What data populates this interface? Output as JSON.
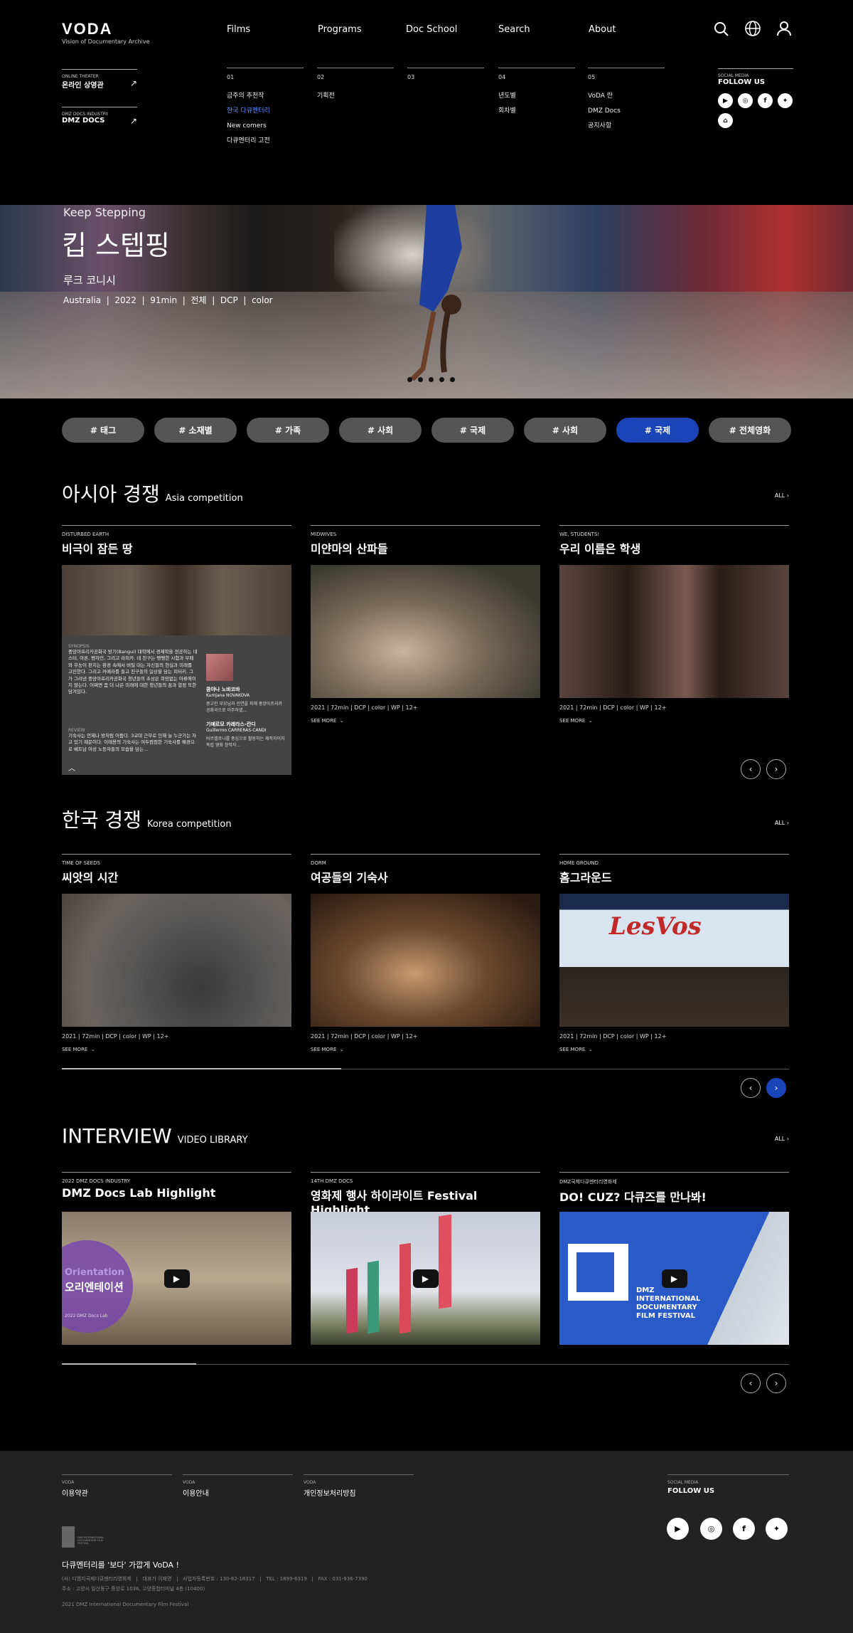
{
  "header": {
    "logo": "VODA",
    "logo_sub": "Vision of Documentary Archive",
    "nav": [
      "Films",
      "Programs",
      "Doc School",
      "Search",
      "About"
    ],
    "side_links": [
      {
        "kicker": "ONLINE THEATER",
        "label": "온라인 상영관"
      },
      {
        "kicker": "DMZ DOCS INDUSTRY",
        "label": "DMZ DOCS"
      }
    ],
    "columns": [
      {
        "num": "01",
        "items": [
          "금주의 추천작",
          "한국 다큐멘터리",
          "New comers",
          "다큐멘터리 고전"
        ],
        "active": 1
      },
      {
        "num": "02",
        "items": [
          "기획전"
        ]
      },
      {
        "num": "03",
        "items": []
      },
      {
        "num": "04",
        "items": [
          "년도별",
          "회차별"
        ]
      },
      {
        "num": "05",
        "items": [
          "VoDA 란",
          "DMZ Docs",
          "공지사항"
        ]
      }
    ],
    "social": {
      "kicker": "SOCIAL MEDIA",
      "label": "FOLLOW US"
    }
  },
  "hero": {
    "en_title": "Keep Stepping",
    "title": "킵 스텝핑",
    "director": "루크 코니시",
    "meta": [
      "Australia",
      "2022",
      "91min",
      "전체",
      "DCP",
      "color"
    ]
  },
  "tags": [
    "# 태그",
    "# 소재별",
    "# 가족",
    "# 사회",
    "# 국제",
    "# 사회",
    "# 국제",
    "# 전체영화"
  ],
  "tag_active": 6,
  "asia": {
    "title": "아시아 경쟁",
    "sub": "Asia competition",
    "all": "ALL",
    "cards": [
      {
        "kicker": "DISTURBED EARTH",
        "title": "비극이 잠든 땅"
      },
      {
        "kicker": "MIDWIVES",
        "title": "미얀마의 산파들",
        "meta": "2021  |  72min  |  DCP  |  color  |  WP  |  12+",
        "see": "SEE MORE"
      },
      {
        "kicker": "WE, STUDENTS!",
        "title": "우리 이름은 학생",
        "meta": "2021  |  72min  |  DCP  |  color  |  WP  |  12+",
        "see": "SEE MORE"
      }
    ],
    "popup": {
      "syn_label": "SYNOPSIS",
      "synopsis": "중앙아프리카공화국 방기(Bangui) 대학에서 경제학을 전공하는 네스터, 아론, 벤자민, 그리고 라피카. 네 친구는 팽팽한 시험과 부패와 무능이 판치는 환경 속에서 버틸 대는 자신들의 현실과 미래를 고민한다. 그리고 카메라를 들고 친구들의 일상을 담는 피터키. 그가 그려낸 중앙아프리카공화국 청년들의 초상은 희망없는 아류에이지 않는다. 어쩌면 좀 더 나은 미래에 대한 청년들의 꿈과 열정 또한 담겨있다.",
      "rev_label": "REVIEW",
      "review": "기숙사는 언제나 방처럼 어둡다. 3교대 근무로 인해 늘 누군가는 자고 있기 때문이다. 이태용의 기숙사는 여두컴컴한 기숙사를 배경으로 베트남 여성 노동자들의 모습을 담는...",
      "people": [
        {
          "name": "쿰야나 노바코바",
          "en": "Kumjana NOVAKOVA",
          "desc": "중고인 부모님과 인연을 피해 중앙아프리카공화국으로 이주하였..."
        },
        {
          "name": "기예르모 카레라스-칸디",
          "en": "Guillermo CARRERAS-CANDI",
          "desc": "바르셀로나를 중심으로 활동하는 제작자이자 독립 영화 창작자..."
        }
      ]
    }
  },
  "korea": {
    "title": "한국 경쟁",
    "sub": "Korea competition",
    "all": "ALL",
    "cards": [
      {
        "kicker": "TIME OF SEEDS",
        "title": "씨앗의 시간",
        "meta": "2021  |  72min  |  DCP  |  color  |  WP  |  12+",
        "see": "SEE MORE"
      },
      {
        "kicker": "DORM",
        "title": "여공들의 기숙사",
        "meta": "2021  |  72min  |  DCP  |  color  |  WP  |  12+",
        "see": "SEE MORE"
      },
      {
        "kicker": "HOME GROUND",
        "title": "홈그라운드",
        "meta": "2021  |  72min  |  DCP  |  color  |  WP  |  12+",
        "see": "SEE MORE",
        "sign": "LesVos"
      }
    ]
  },
  "interview": {
    "title": "INTERVIEW",
    "sub": "VIDEO LIBRARY",
    "all": "ALL",
    "cards": [
      {
        "kicker": "2022 DMZ DOCS INDUSTRY",
        "title": "DMZ Docs Lab Highlight",
        "overlay": "Orientation",
        "overlay_kr": "오리엔테이션",
        "corner": "2022 DMZ Docs Lab"
      },
      {
        "kicker": "14TH DMZ DOCS",
        "title": "영화제 행사 하이라이트 Festival Highlight"
      },
      {
        "kicker": "DMZ국제다큐멘터리영화제",
        "title": "DO! CUZ? 다큐즈를 만나봐!",
        "overlay": "DMZ INTERNATIONAL DOCUMENTARY FILM FESTIVAL"
      }
    ]
  },
  "footer": {
    "cols": [
      {
        "kicker": "VODA",
        "label": "이용약관"
      },
      {
        "kicker": "VODA",
        "label": "이용안내"
      },
      {
        "kicker": "VODA",
        "label": "개인정보처리방침"
      }
    ],
    "social": {
      "kicker": "SOCIAL MEDIA",
      "label": "FOLLOW US"
    },
    "slogan": "다큐멘터리를 '보다' 가깝게 VoDA !",
    "info1": "(사) 디엠지국제다큐멘터리영화제   |   대표가 이재명   |   사업자등록번호 : 130-82-18317   |   TEL : 1899-6319   |   FAX : 031-936-7390",
    "info2": "주소 : 고양시 일산동구 중앙로 1036, 고양종합터미널 4층 (10400)",
    "copy": "2021 DMZ International Documentary Film Festival",
    "logo_text": "DMZ INTERNATIONAL DOCUMENTARY FILM FESTIVAL"
  },
  "colors": {
    "accent": "#1a44b8",
    "active_link": "#5a8cff",
    "tag": "#555555",
    "footer_bg": "#222222"
  }
}
